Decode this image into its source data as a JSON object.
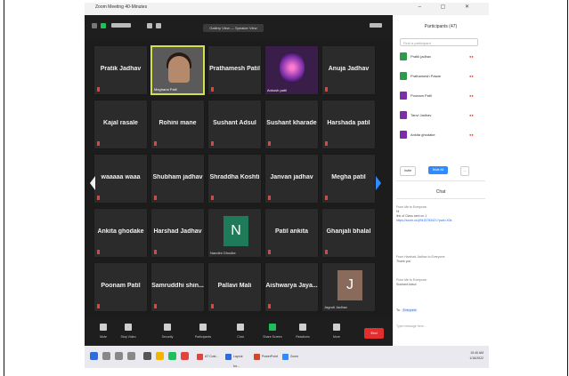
{
  "window": {
    "title": "Zoom Meeting 40-Minutes",
    "controls": "–  ▢  ✕"
  },
  "topbar": {
    "view_button": "Gallery View — Speaker View"
  },
  "grid": {
    "tiles": [
      {
        "name": "Pratik Jadhav",
        "type": "text"
      },
      {
        "name": "",
        "type": "video",
        "label": "Meghana Patil"
      },
      {
        "name": "Prathamesh Patil",
        "type": "text"
      },
      {
        "name": "",
        "type": "image",
        "label": "Ankush patil"
      },
      {
        "name": "Anuja Jadhav",
        "type": "text"
      },
      {
        "name": "Kajal rasale",
        "type": "text"
      },
      {
        "name": "Rohini mane",
        "type": "text"
      },
      {
        "name": "Sushant Adsul",
        "type": "text"
      },
      {
        "name": "Sushant kharade",
        "type": "text"
      },
      {
        "name": "Harshada patil",
        "type": "text"
      },
      {
        "name": "waaaaa waaa",
        "type": "text"
      },
      {
        "name": "Shubham jadhav",
        "type": "text"
      },
      {
        "name": "Shraddha Koshti",
        "type": "text"
      },
      {
        "name": "Janvan jadhav",
        "type": "text"
      },
      {
        "name": "Megha patil",
        "type": "text"
      },
      {
        "name": "Ankita ghodake",
        "type": "text"
      },
      {
        "name": "Harshad Jadhav",
        "type": "text"
      },
      {
        "name": "",
        "type": "avatar",
        "letter": "N",
        "label": "Nandini Ghodke",
        "color": "#1f7a5a"
      },
      {
        "name": "Patil ankita",
        "type": "text"
      },
      {
        "name": "Ghanjali bhalal",
        "type": "text"
      },
      {
        "name": "Poonam Patil",
        "type": "text"
      },
      {
        "name": "Samruddhi shin...",
        "type": "text"
      },
      {
        "name": "Pallavi Mali",
        "type": "text"
      },
      {
        "name": "Aishwarya Jaya...",
        "type": "text"
      },
      {
        "name": "",
        "type": "avatar",
        "letter": "J",
        "label": "Jagruti Jadhav",
        "color": "#8a6a5a"
      }
    ]
  },
  "toolbar": {
    "items": [
      {
        "label": "Mute",
        "icon": "mic-icon"
      },
      {
        "label": "Stop Video",
        "icon": "video-icon"
      },
      {
        "label": "Security",
        "icon": "shield-icon"
      },
      {
        "label": "Participants",
        "icon": "people-icon"
      },
      {
        "label": "Chat",
        "icon": "chat-icon"
      },
      {
        "label": "Share Screen",
        "icon": "share-icon"
      },
      {
        "label": "Reactions",
        "icon": "smile-icon"
      },
      {
        "label": "More",
        "icon": "more-icon"
      }
    ],
    "end": "End"
  },
  "panel": {
    "title": "Participants (47)",
    "search_placeholder": "Find a participant",
    "participants": [
      {
        "name": "Pratik jadhav",
        "color": "#2b9a4a"
      },
      {
        "name": "Prathamesh Pawar",
        "color": "#2b9a4a"
      },
      {
        "name": "Poonam Patil",
        "color": "#7a2ea8"
      },
      {
        "name": "Tanvi Jadhav",
        "color": "#7a2ea8"
      },
      {
        "name": "Ankita ghodake",
        "color": "#7a2ea8"
      }
    ],
    "invite": "Invite",
    "mute_all": "Mute All",
    "more": "..."
  },
  "chat": {
    "title": "Chat",
    "messages": [
      {
        "from": "From Me to Everyone:",
        "lines": [
          "Hi",
          "link of Class sent on 1"
        ],
        "link": "https://zoom.us/j/9415783421?pwd=X0k"
      },
      {
        "from": "From Harshad Jadhav to Everyone:",
        "lines": [
          "Thank you"
        ],
        "link": ""
      },
      {
        "from": "From Me to Everyone:",
        "lines": [
          "Sushant Adsul"
        ],
        "link": ""
      }
    ],
    "to_label": "To:",
    "to_value": "Everyone",
    "input_placeholder": "Type message here..."
  },
  "taskbar": {
    "apps": [
      {
        "label": "AT Cost...",
        "color": "#e0443c"
      },
      {
        "label": "Layout for...",
        "color": "#2d6cdf"
      },
      {
        "label": "PowerPoint",
        "color": "#d24726"
      },
      {
        "label": "Zoom",
        "color": "#2d8cff"
      }
    ],
    "time": "10:40 AM",
    "date": "1/16/2022"
  }
}
